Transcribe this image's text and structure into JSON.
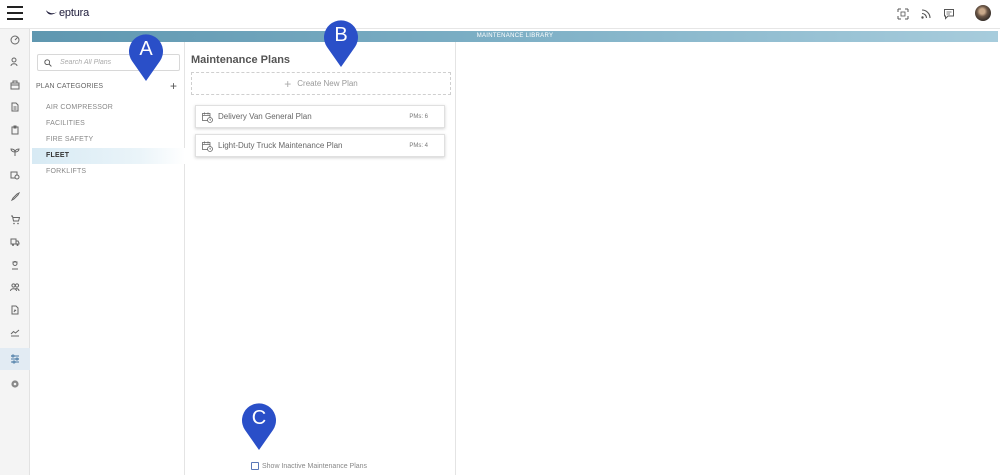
{
  "app": {
    "logo_text": "eptura",
    "module_title": "MAINTENANCE LIBRARY"
  },
  "topbar": {
    "icons": [
      "qr-code-icon",
      "rss-feed-icon",
      "chat-icon",
      "user-avatar"
    ]
  },
  "rail": {
    "items": [
      "dashboard-icon",
      "people-icon",
      "inventory-icon",
      "document-icon",
      "clipboard-icon",
      "plant-icon",
      "schedule-icon",
      "rocket-icon",
      "cart-icon",
      "truck-icon",
      "worker-icon",
      "team-icon",
      "report-icon",
      "analytics-icon",
      "settings-sliders-icon",
      "gear-icon"
    ],
    "active_index": 14
  },
  "categories": {
    "search_placeholder": "Search All Plans",
    "heading": "PLAN CATEGORIES",
    "add_symbol": "+",
    "items": [
      "AIR COMPRESSOR",
      "FACILITIES",
      "FIRE SAFETY",
      "FLEET",
      "FORKLIFTS"
    ],
    "selected": "FLEET"
  },
  "plans": {
    "title": "Maintenance Plans",
    "create_label": "Create New Plan",
    "create_symbol": "+",
    "items": [
      {
        "name": "Delivery Van General Plan",
        "pms": "PMs: 6"
      },
      {
        "name": "Light-Duty Truck Maintenance Plan",
        "pms": "PMs: 4"
      }
    ],
    "show_inactive_label": "Show Inactive Maintenance Plans",
    "show_inactive_checked": false
  },
  "callouts": {
    "a": "A",
    "b": "B",
    "c": "C"
  },
  "colors": {
    "marker": "#2a4fc8",
    "band": "#7eb0c6",
    "selected_category": "#d7eaf4"
  }
}
